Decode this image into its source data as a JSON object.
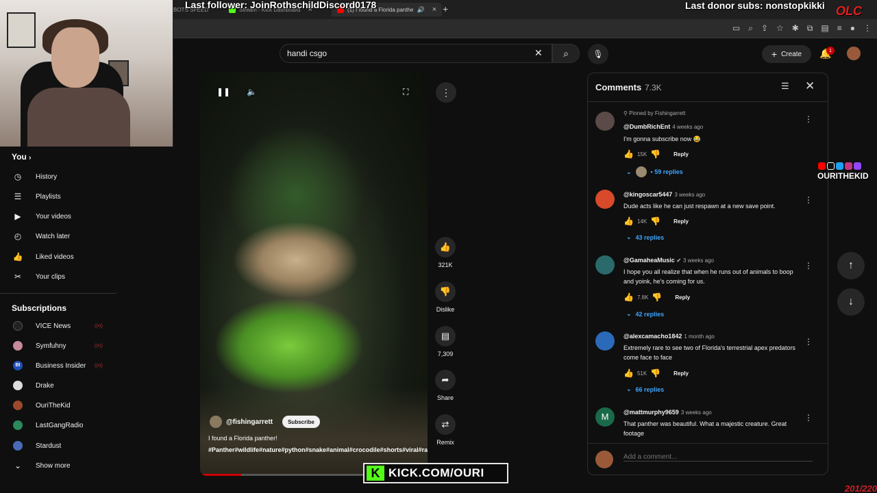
{
  "overlay": {
    "last_follower": "Last follower: JoinRothschildDiscord0178",
    "last_donor": "Last donor subs: nonstopkikki",
    "olc": "OLC",
    "counter": "201/220",
    "kick_text": "KICK.COM/OURI",
    "kick_letter": "K",
    "channel_brand": "OURITHEKID"
  },
  "browser": {
    "tabs": [
      {
        "label": "BOTS SPEED",
        "active": false
      },
      {
        "label": "Stream - Kick Dashboard",
        "active": false
      },
      {
        "label": "(1) I found a Florida panthe",
        "active": true
      }
    ]
  },
  "header": {
    "search_value": "handi csgo",
    "create_label": "Create",
    "notification_count": "1"
  },
  "sidebar": {
    "you_label": "You",
    "items": [
      {
        "label": "History",
        "icon": "history-icon",
        "glyph": "◷"
      },
      {
        "label": "Playlists",
        "icon": "playlists-icon",
        "glyph": "☰"
      },
      {
        "label": "Your videos",
        "icon": "your-videos-icon",
        "glyph": "▶"
      },
      {
        "label": "Watch later",
        "icon": "watch-later-icon",
        "glyph": "◴"
      },
      {
        "label": "Liked videos",
        "icon": "liked-videos-icon",
        "glyph": "👍"
      },
      {
        "label": "Your clips",
        "icon": "clips-icon",
        "glyph": "✂"
      }
    ],
    "subscriptions_label": "Subscriptions",
    "subscriptions": [
      {
        "name": "VICE News",
        "color": "#222222"
      },
      {
        "name": "Symfuhny",
        "color": "#c98a9a"
      },
      {
        "name": "Business Insider",
        "color": "#1f4fb8"
      },
      {
        "name": "Drake",
        "color": "#dddddd"
      },
      {
        "name": "OuriTheKid",
        "color": "#9a4a2a"
      },
      {
        "name": "LastGangRadio",
        "color": "#2a8a5a"
      },
      {
        "name": "Stardust",
        "color": "#4a6ab8"
      }
    ],
    "show_more_label": "Show more"
  },
  "video": {
    "channel": "@fishingarrett",
    "subscribe_label": "Subscribe",
    "title": "I found a Florida panther!",
    "tags": "#Panther#wildlife#nature#python#snake#animal#crocodile#shorts#viral#rare",
    "progress": 0.18
  },
  "actions": {
    "likes": "321K",
    "dislike": "Dislike",
    "comments": "7,309",
    "share": "Share",
    "remix": "Remix"
  },
  "comments_panel": {
    "title": "Comments",
    "count": "7.3K",
    "add_placeholder": "Add a comment...",
    "reply_label": "Reply",
    "pinned_label": "Pinned by Fishingarrett",
    "comments": [
      {
        "author": "@DumbRichEnt",
        "time": "4 weeks ago",
        "text": "I'm gonna subscribe now 😂",
        "likes": "15K",
        "replies": "• 59 replies",
        "avatar_color": "#5a4a48"
      },
      {
        "author": "@kingoscar5447",
        "time": "3 weeks ago",
        "text": "Dude acts like he can just respawn at a new save point.",
        "likes": "14K",
        "replies": "43 replies",
        "avatar_color": "#d84a2a"
      },
      {
        "author": "@GamaheaMusic",
        "time": "3 weeks ago",
        "text": "I hope you all realize that when he runs out of animals to boop and yoink, he's coming for us.",
        "likes": "7.8K",
        "replies": "42 replies",
        "avatar_color": "#2a6a6a"
      },
      {
        "author": "@alexcamacho1842",
        "time": "1 month ago",
        "text": "Extremely rare to see two of Florida's terrestrial apex predators come face to face",
        "likes": "51K",
        "replies": "66 replies",
        "avatar_color": "#2a6ab8"
      },
      {
        "author": "@mattmurphy9659",
        "time": "3 weeks ago",
        "text": "That panther was beautiful. What a majestic creature. Great footage",
        "likes": "",
        "replies": "",
        "avatar_color": "#1a6a4a",
        "initial": "M"
      }
    ]
  }
}
